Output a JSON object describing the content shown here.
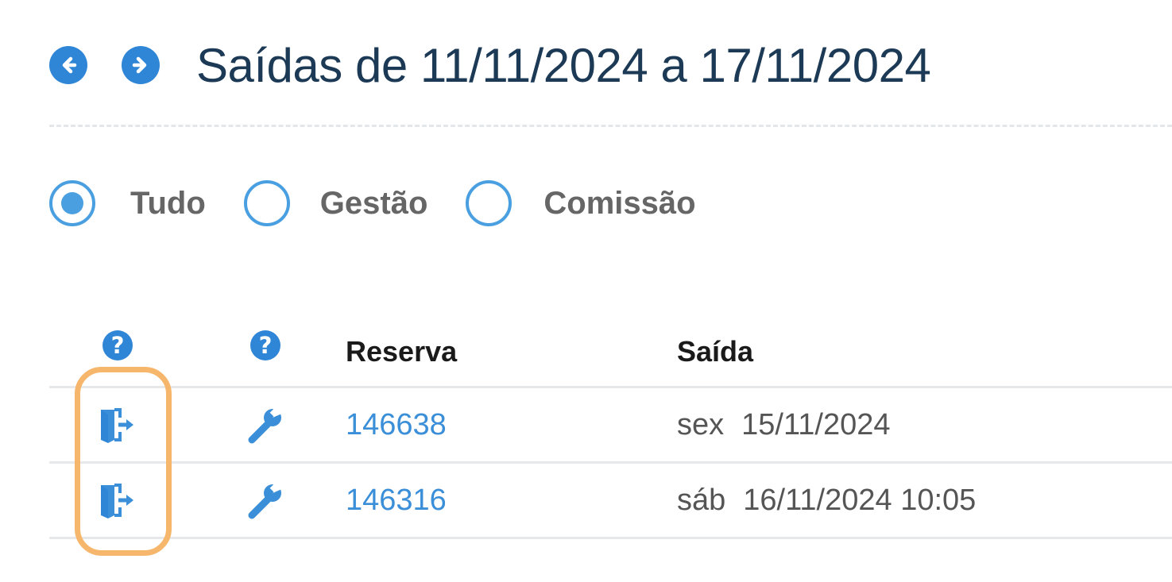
{
  "header": {
    "title": "Saídas de 11/11/2024 a 17/11/2024",
    "prev_icon": "circle-arrow-left-icon",
    "next_icon": "circle-arrow-right-icon"
  },
  "filters": {
    "selected": "Tudo",
    "options": [
      {
        "label": "Tudo"
      },
      {
        "label": "Gestão"
      },
      {
        "label": "Comissão"
      }
    ]
  },
  "table": {
    "columns": {
      "exit_help": "?",
      "tool_help": "?",
      "reserva": "Reserva",
      "saida": "Saída"
    },
    "rows": [
      {
        "reserva": "146638",
        "day": "sex",
        "datetime": "15/11/2024"
      },
      {
        "reserva": "146316",
        "day": "sáb",
        "datetime": "16/11/2024 10:05"
      }
    ]
  },
  "colors": {
    "accent": "#2f86d6",
    "radio": "#4a9fe0",
    "title": "#1c3a56",
    "link": "#3a8fd8",
    "highlight": "#f6b76c"
  }
}
